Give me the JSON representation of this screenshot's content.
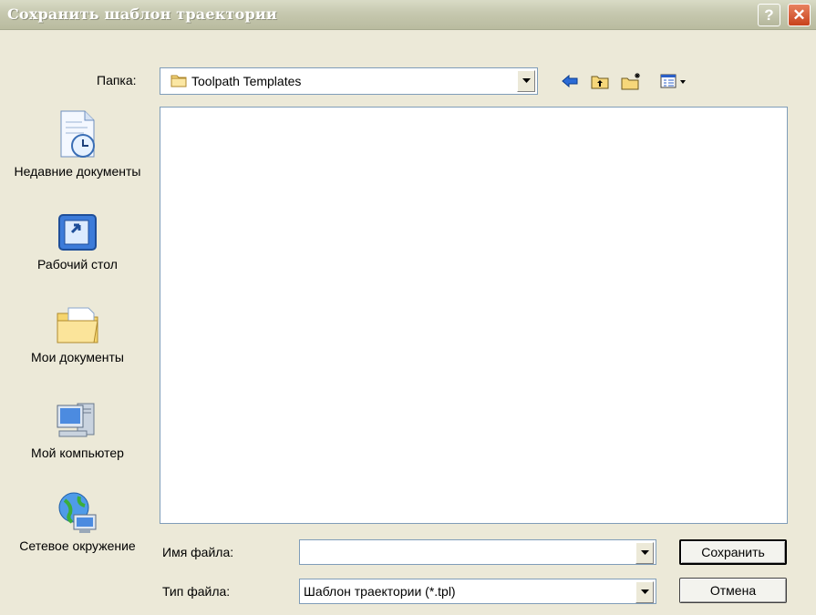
{
  "window": {
    "title": "Сохранить шаблон траектории"
  },
  "folder": {
    "label": "Папка:",
    "value": "Toolpath Templates"
  },
  "places": [
    {
      "label": "Недавние документы",
      "icon": "recent-documents-icon"
    },
    {
      "label": "Рабочий стол",
      "icon": "desktop-icon"
    },
    {
      "label": "Мои документы",
      "icon": "my-documents-icon"
    },
    {
      "label": "Мой компьютер",
      "icon": "my-computer-icon"
    },
    {
      "label": "Сетевое окружение",
      "icon": "network-places-icon"
    }
  ],
  "filename": {
    "label": "Имя файла:",
    "value": ""
  },
  "filetype": {
    "label": "Тип файла:",
    "value": "Шаблон траектории (*.tpl)"
  },
  "buttons": {
    "save": "Сохранить",
    "cancel": "Отмена",
    "help": "?",
    "close": "✕"
  },
  "colors": {
    "titlebar": "#C6C8AF",
    "dialog_bg": "#ECE9D8",
    "close_red": "#D9542B",
    "field_border": "#7F9DB9"
  }
}
